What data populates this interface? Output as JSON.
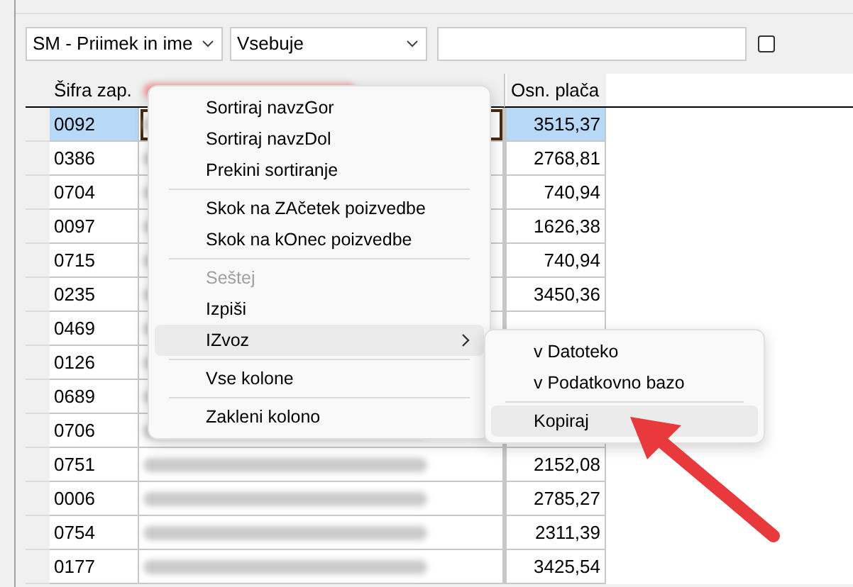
{
  "filter": {
    "field": "SM - Priimek in ime",
    "operator": "Vsebuje",
    "checkbox": {
      "checked": false
    }
  },
  "table": {
    "columns": [
      {
        "kind": "text",
        "label": "Šifra zap."
      },
      {
        "kind": "redacted"
      },
      {
        "kind": "text",
        "label": "Osn. plača"
      }
    ],
    "rows": [
      {
        "code": "0092",
        "salary": "3515,37",
        "selected": true
      },
      {
        "code": "0386",
        "salary": "2768,81",
        "selected": false
      },
      {
        "code": "0704",
        "salary": "740,94",
        "selected": false
      },
      {
        "code": "0097",
        "salary": "1626,38",
        "selected": false
      },
      {
        "code": "0715",
        "salary": "740,94",
        "selected": false
      },
      {
        "code": "0235",
        "salary": "3450,36",
        "selected": false
      },
      {
        "code": "0469",
        "selected": false
      },
      {
        "code": "0126",
        "selected": false
      },
      {
        "code": "0689",
        "selected": false
      },
      {
        "code": "0706",
        "selected": false
      },
      {
        "code": "0751",
        "salary": "2152,08",
        "selected": false
      },
      {
        "code": "0006",
        "salary": "2785,27",
        "selected": false
      },
      {
        "code": "0754",
        "salary": "2311,39",
        "selected": false
      },
      {
        "code": "0177",
        "salary": "3425,54",
        "selected": false
      }
    ]
  },
  "context_menu": {
    "items": [
      {
        "kind": "item",
        "label": "Sortiraj navzGor",
        "disabled": false,
        "selected": false
      },
      {
        "kind": "item",
        "label": "Sortiraj navzDol",
        "disabled": false,
        "selected": false
      },
      {
        "kind": "item",
        "label": "Prekini sortiranje",
        "disabled": false,
        "selected": false
      },
      {
        "kind": "separator"
      },
      {
        "kind": "item",
        "label": "Skok na ZAčetek poizvedbe",
        "disabled": false,
        "selected": false
      },
      {
        "kind": "item",
        "label": "Skok na kOnec poizvedbe",
        "disabled": false,
        "selected": false
      },
      {
        "kind": "separator"
      },
      {
        "kind": "item",
        "label": "Seštej",
        "disabled": true,
        "selected": false
      },
      {
        "kind": "item",
        "label": "Izpiši",
        "disabled": false,
        "selected": false
      },
      {
        "kind": "submenu",
        "label": "IZvoz",
        "disabled": false,
        "selected": true
      },
      {
        "kind": "separator"
      },
      {
        "kind": "item",
        "label": "Vse kolone",
        "disabled": false,
        "selected": false
      },
      {
        "kind": "separator"
      },
      {
        "kind": "item",
        "label": "Zakleni kolono",
        "disabled": false,
        "selected": false
      }
    ]
  },
  "submenu": {
    "items": [
      {
        "kind": "item",
        "label": "v Datoteko",
        "selected": false
      },
      {
        "kind": "item",
        "label": "v Podatkovno bazo",
        "selected": false
      },
      {
        "kind": "separator"
      },
      {
        "kind": "item",
        "label": "Kopiraj",
        "selected": true
      }
    ]
  }
}
